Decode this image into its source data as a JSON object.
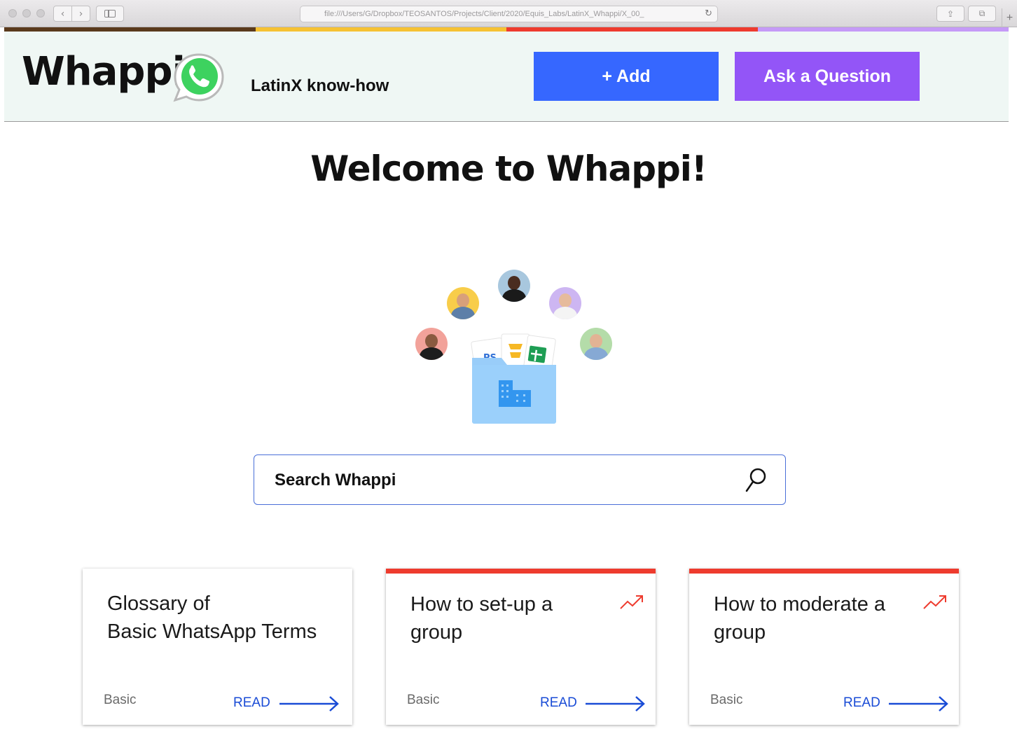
{
  "browser": {
    "url": "file:///Users/G/Dropbox/TEOSANTOS/Projects/Client/2020/Equis_Labs/LatinX_Whappi/X_00_",
    "reload_glyph": "↻",
    "back_glyph": "‹",
    "forward_glyph": "›",
    "share_glyph": "⇪",
    "tabs_glyph": "⧉",
    "new_tab_glyph": "+"
  },
  "colors": {
    "strip": [
      "#5a3a1c",
      "#f6c233",
      "#ee3b2e",
      "#c59af7"
    ],
    "add_button": "#3667ff",
    "ask_button": "#9355f7",
    "header_bg": "#eff7f4",
    "accent_link": "#1a4cd6",
    "trending": "#ee3b2e",
    "whatsapp_green": "#3dd25f"
  },
  "header": {
    "logo_text": "Whappi",
    "logo_icon": "whatsapp-icon",
    "tagline": "LatinX know-how",
    "add_label": "+ Add",
    "ask_label": "Ask a Question"
  },
  "main": {
    "welcome": "Welcome to Whappi!",
    "hero_icons": [
      "avatar",
      "folder-icon",
      "docs-icon",
      "slides-icon",
      "sheets-icon",
      "building-icon"
    ],
    "search_placeholder": "Search Whappi",
    "search_icon": "search-icon"
  },
  "cards": [
    {
      "title": "Glossary of\nBasic WhatsApp  Terms",
      "level": "Basic",
      "read": "READ",
      "trending": false
    },
    {
      "title": "How to set-up a group",
      "level": "Basic",
      "read": "READ",
      "trending": true
    },
    {
      "title": "How to moderate a group",
      "level": "Basic",
      "read": "READ",
      "trending": true
    }
  ]
}
